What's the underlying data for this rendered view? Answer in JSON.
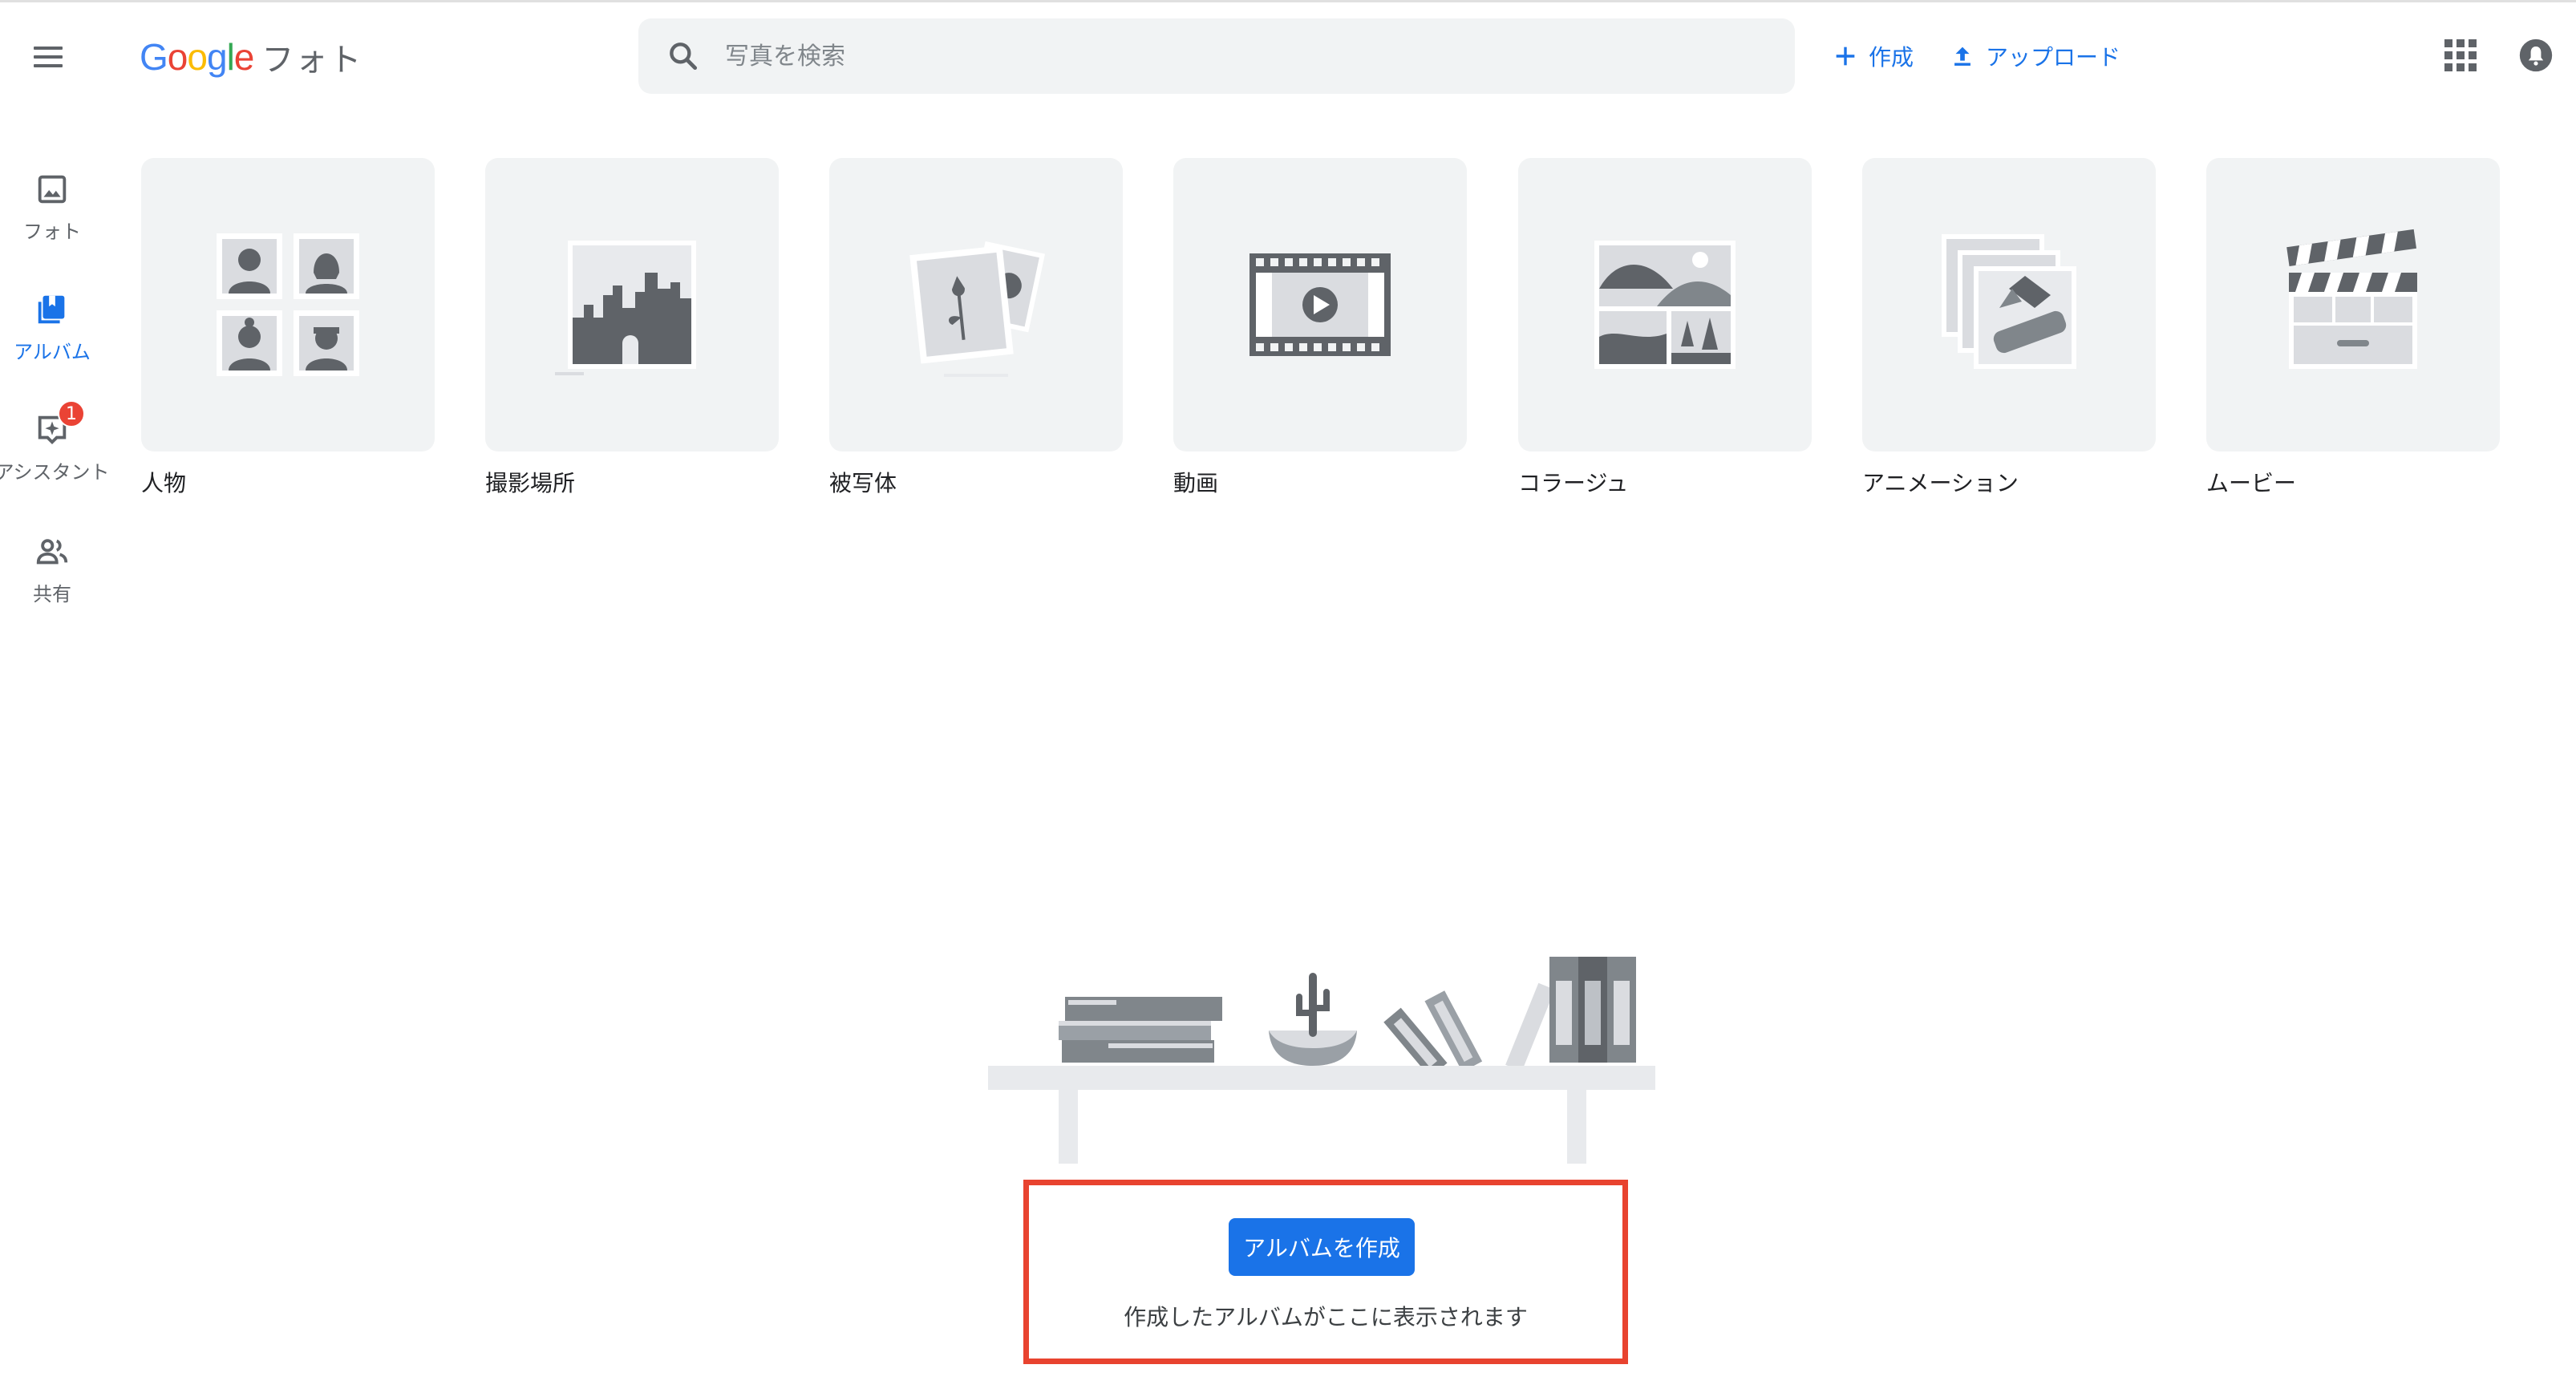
{
  "header": {
    "logo_google": [
      "G",
      "o",
      "o",
      "g",
      "l",
      "e"
    ],
    "product_name": "フォト",
    "search_placeholder": "写真を検索",
    "create_label": "作成",
    "upload_label": "アップロード"
  },
  "sidebar": {
    "items": [
      {
        "label": "フォト",
        "icon": "photo-icon",
        "active": false
      },
      {
        "label": "アルバム",
        "icon": "album-icon",
        "active": true
      },
      {
        "label": "アシスタント",
        "icon": "assistant-icon",
        "active": false,
        "badge": "1"
      },
      {
        "label": "共有",
        "icon": "people-icon",
        "active": false
      }
    ]
  },
  "categories": [
    {
      "label": "人物",
      "icon": "people-illustration"
    },
    {
      "label": "撮影場所",
      "icon": "places-illustration"
    },
    {
      "label": "被写体",
      "icon": "things-illustration"
    },
    {
      "label": "動画",
      "icon": "video-illustration"
    },
    {
      "label": "コラージュ",
      "icon": "collage-illustration"
    },
    {
      "label": "アニメーション",
      "icon": "animation-illustration"
    },
    {
      "label": "ムービー",
      "icon": "movie-illustration"
    }
  ],
  "empty_state": {
    "button_label": "アルバムを作成",
    "message": "作成したアルバムがここに表示されます"
  },
  "colors": {
    "accent": "#1a73e8",
    "badge": "#ea4335",
    "highlight_border": "#e8432f",
    "tile_bg": "#f1f3f4"
  }
}
